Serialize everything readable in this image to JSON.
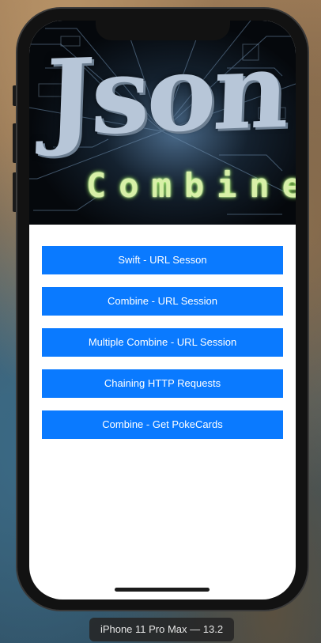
{
  "banner": {
    "title": "Json",
    "subtitle": "Combine"
  },
  "buttons": [
    {
      "label": "Swift - URL Sesson"
    },
    {
      "label": "Combine - URL Session"
    },
    {
      "label": "Multiple Combine - URL Session"
    },
    {
      "label": "Chaining HTTP Requests"
    },
    {
      "label": "Combine - Get PokeCards"
    }
  ],
  "simulator": {
    "device_label": "iPhone 11 Pro Max — 13.2"
  },
  "colors": {
    "button_background": "#0a7aff",
    "button_text": "#ffffff",
    "screen_background": "#ffffff"
  }
}
